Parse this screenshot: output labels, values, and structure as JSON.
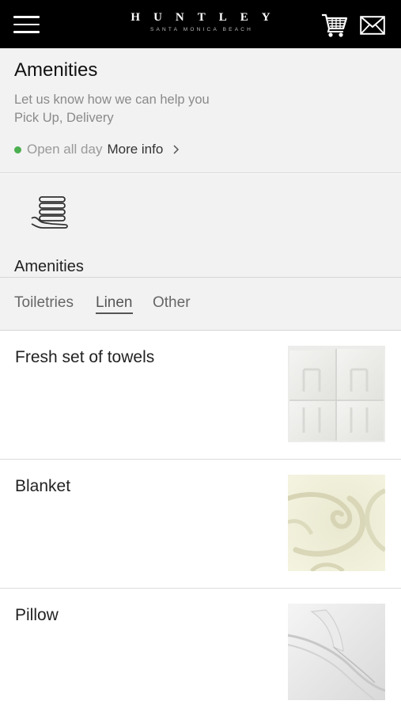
{
  "header": {
    "brand_name": "HUNTLEY",
    "brand_tagline": "SANTA MONICA BEACH",
    "icons": {
      "menu": "hamburger-menu-icon",
      "cart": "cart-icon",
      "mail": "mail-icon"
    }
  },
  "info": {
    "title": "Amenities",
    "subtitle_line1": "Let us know how we can help you",
    "subtitle_line2": "Pick Up, Delivery",
    "status_text": "Open all day",
    "more_info_label": "More info",
    "status_color": "#4caf50"
  },
  "category": {
    "label": "Amenities",
    "icon": "towels-in-hand-icon"
  },
  "tabs": [
    {
      "label": "Toiletries",
      "active": false
    },
    {
      "label": "Linen",
      "active": true
    },
    {
      "label": "Other",
      "active": false
    }
  ],
  "items": [
    {
      "name": "Fresh set of towels",
      "image": "folded-towels-photo"
    },
    {
      "name": "Blanket",
      "image": "fleece-blanket-photo"
    },
    {
      "name": "Pillow",
      "image": "pillow-photo"
    }
  ]
}
